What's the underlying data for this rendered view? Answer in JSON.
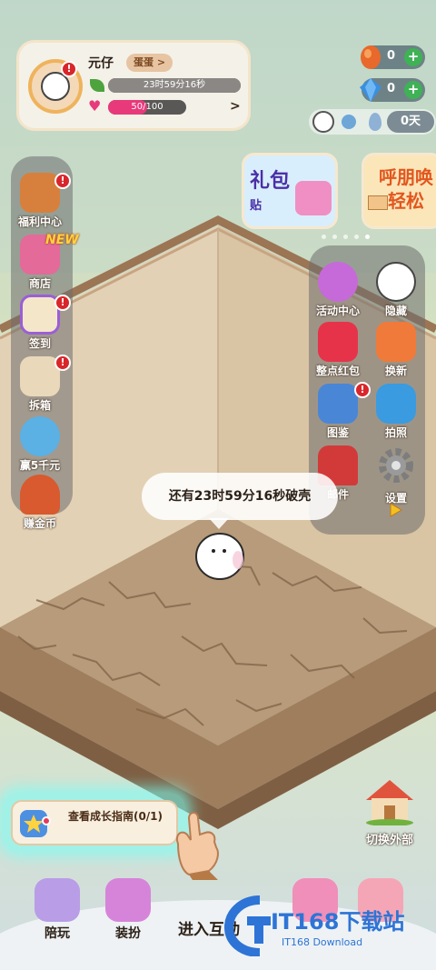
{
  "profile": {
    "name": "元仔",
    "tag": "蛋蛋 >",
    "timer": "23时59分16秒",
    "timer_progress": 1.0,
    "energy": "50/100",
    "energy_progress": 0.5,
    "more": ">"
  },
  "currency": {
    "gold": "0",
    "diamond": "0",
    "plus": "+"
  },
  "subbar": {
    "days": "0天"
  },
  "badges": {
    "alert": "!",
    "new": "NEW"
  },
  "left_menu": [
    {
      "label": "福利中心",
      "icon": "gift-chest-icon"
    },
    {
      "label": "商店",
      "icon": "shop-icon"
    },
    {
      "label": "签到",
      "icon": "checkin-clipboard-icon"
    },
    {
      "label": "拆箱",
      "icon": "ribbon-box-icon"
    },
    {
      "label": "赢5千元",
      "icon": "globe-icon"
    },
    {
      "label": "赚金币",
      "icon": "mushroom-house-icon"
    }
  ],
  "banners": {
    "left_text": "礼包",
    "left_sub": "贴",
    "right_line1": "呼朋唤",
    "right_line2": "轻松"
  },
  "right_menu": [
    {
      "label": "活动中心",
      "icon": "fireworks-icon"
    },
    {
      "label": "隐藏",
      "icon": "hide-cat-icon"
    },
    {
      "label": "整点红包",
      "icon": "red-packet-icon"
    },
    {
      "label": "换新",
      "icon": "refresh-house-icon"
    },
    {
      "label": "图鉴",
      "icon": "album-icon"
    },
    {
      "label": "拍照",
      "icon": "camera-icon"
    },
    {
      "label": "邮件",
      "icon": "mailbox-icon"
    },
    {
      "label": "设置",
      "icon": "gear-icon"
    }
  ],
  "bubble": {
    "text": "还有23时59分16秒破壳"
  },
  "guide": {
    "text": "查看成长指南(0/1)"
  },
  "switch": {
    "label": "切换外部"
  },
  "bottom": {
    "play": "陪玩",
    "dress": "装扮",
    "enter": "进入互动",
    "right1": "",
    "right2": ""
  },
  "watermark": {
    "main": "IT168下载站",
    "sub": "IT168 Download"
  },
  "colors": {
    "wall": "#e3d0b3",
    "floor": "#b89a7a",
    "panel": "#6e6e6e",
    "alert": "#d9262a",
    "guide_glow": "#78fff5"
  }
}
